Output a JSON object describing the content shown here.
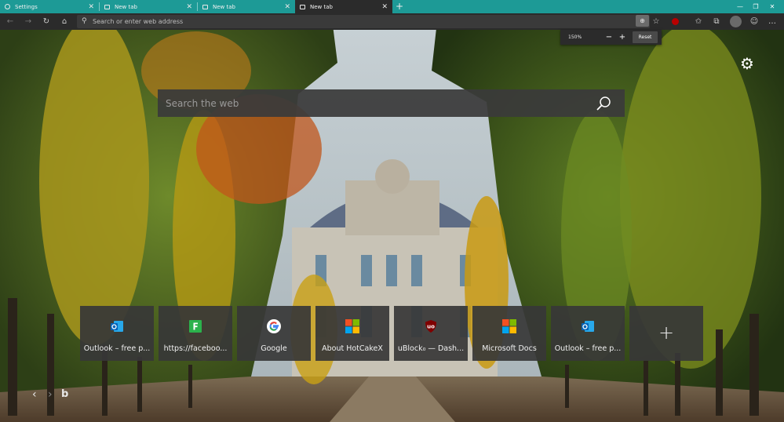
{
  "tabs": [
    {
      "label": "Settings",
      "icon": "gear-icon",
      "active": false
    },
    {
      "label": "New tab",
      "icon": "page-icon",
      "active": false
    },
    {
      "label": "New tab",
      "icon": "page-icon",
      "active": false
    },
    {
      "label": "New tab",
      "icon": "page-icon",
      "active": true
    }
  ],
  "toolbar": {
    "address_placeholder": "Search or enter web address"
  },
  "zoom": {
    "level": "150%",
    "minus": "−",
    "plus": "+",
    "reset_label": "Reset"
  },
  "newtab_page": {
    "search_placeholder": "Search the web",
    "tiles": [
      {
        "label": "Outlook – free p...",
        "icon": "outlook-icon"
      },
      {
        "label": "https://faceboo...",
        "icon": "feedly-icon"
      },
      {
        "label": "Google",
        "icon": "google-icon"
      },
      {
        "label": "About HotCakeX",
        "icon": "microsoft-icon"
      },
      {
        "label": "uBlock₀ — Dash...",
        "icon": "ublock-icon"
      },
      {
        "label": "Microsoft Docs",
        "icon": "microsoft-icon"
      },
      {
        "label": "Outlook – free p...",
        "icon": "outlook-icon"
      }
    ]
  },
  "colors": {
    "titlebar": "#1d9a96",
    "toolbar": "#2b2b2b",
    "tile_bg": "#373737"
  }
}
